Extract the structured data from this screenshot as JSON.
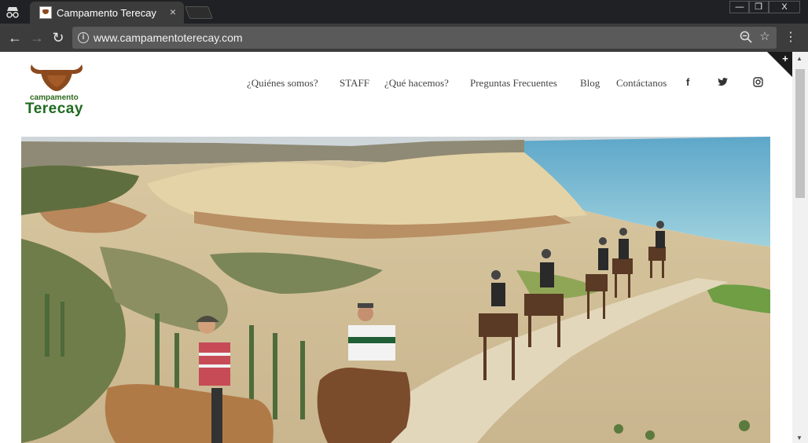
{
  "browser": {
    "tab_title": "Campamento Terecay",
    "tab_close": "×",
    "url": "www.campamentoterecay.com",
    "window_controls": {
      "minimize": "—",
      "restore": "❐",
      "close": "X"
    }
  },
  "site": {
    "logo": {
      "small_text": "campamento",
      "big_text": "Terecay"
    },
    "nav": [
      "¿Quiénes somos?",
      "STAFF",
      "¿Qué hacemos?",
      "Preguntas Frecuentes",
      "Blog",
      "Contáctanos"
    ],
    "social": {
      "facebook": "f",
      "twitter": "🐦",
      "instagram": "◎"
    },
    "corner_button": "+"
  },
  "colors": {
    "chrome_dark": "#202124",
    "toolbar": "#3c3c3c",
    "logo_green": "#1f6b20",
    "logo_brown": "#8b4a1e",
    "nav_text": "#444444"
  },
  "icons": [
    "incognito-icon",
    "back-icon",
    "forward-icon",
    "reload-icon",
    "info-icon",
    "zoom-icon",
    "star-icon",
    "menu-icon",
    "facebook-icon",
    "twitter-icon",
    "instagram-icon"
  ]
}
